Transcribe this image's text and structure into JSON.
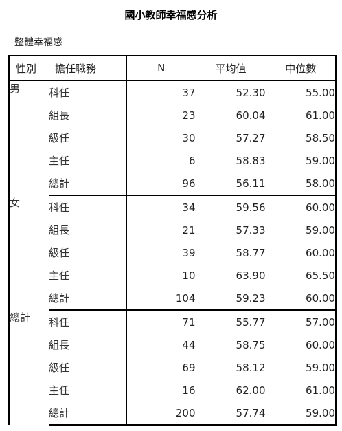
{
  "title": "國小教師幸福感分析",
  "subtitle": "整體幸福感",
  "table": {
    "headers": {
      "gender": "性別",
      "role": "擔任職務",
      "n": "N",
      "mean": "平均值",
      "median": "中位數"
    },
    "groups": [
      {
        "gender": "男",
        "rows": [
          {
            "role": "科任",
            "n": "37",
            "mean": "52.30",
            "median": "55.00"
          },
          {
            "role": "組長",
            "n": "23",
            "mean": "60.04",
            "median": "61.00"
          },
          {
            "role": "級任",
            "n": "30",
            "mean": "57.27",
            "median": "58.50"
          },
          {
            "role": "主任",
            "n": "6",
            "mean": "58.83",
            "median": "59.00"
          },
          {
            "role": "總計",
            "n": "96",
            "mean": "56.11",
            "median": "58.00"
          }
        ]
      },
      {
        "gender": "女",
        "rows": [
          {
            "role": "科任",
            "n": "34",
            "mean": "59.56",
            "median": "60.00"
          },
          {
            "role": "組長",
            "n": "21",
            "mean": "57.33",
            "median": "59.00"
          },
          {
            "role": "級任",
            "n": "39",
            "mean": "58.77",
            "median": "60.00"
          },
          {
            "role": "主任",
            "n": "10",
            "mean": "63.90",
            "median": "65.50"
          },
          {
            "role": "總計",
            "n": "104",
            "mean": "59.23",
            "median": "60.00"
          }
        ]
      },
      {
        "gender": "總計",
        "rows": [
          {
            "role": "科任",
            "n": "71",
            "mean": "55.77",
            "median": "57.00"
          },
          {
            "role": "組長",
            "n": "44",
            "mean": "58.75",
            "median": "60.00"
          },
          {
            "role": "級任",
            "n": "69",
            "mean": "58.12",
            "median": "59.00"
          },
          {
            "role": "主任",
            "n": "16",
            "mean": "62.00",
            "median": "61.00"
          },
          {
            "role": "總計",
            "n": "200",
            "mean": "57.74",
            "median": "59.00"
          }
        ]
      }
    ]
  }
}
